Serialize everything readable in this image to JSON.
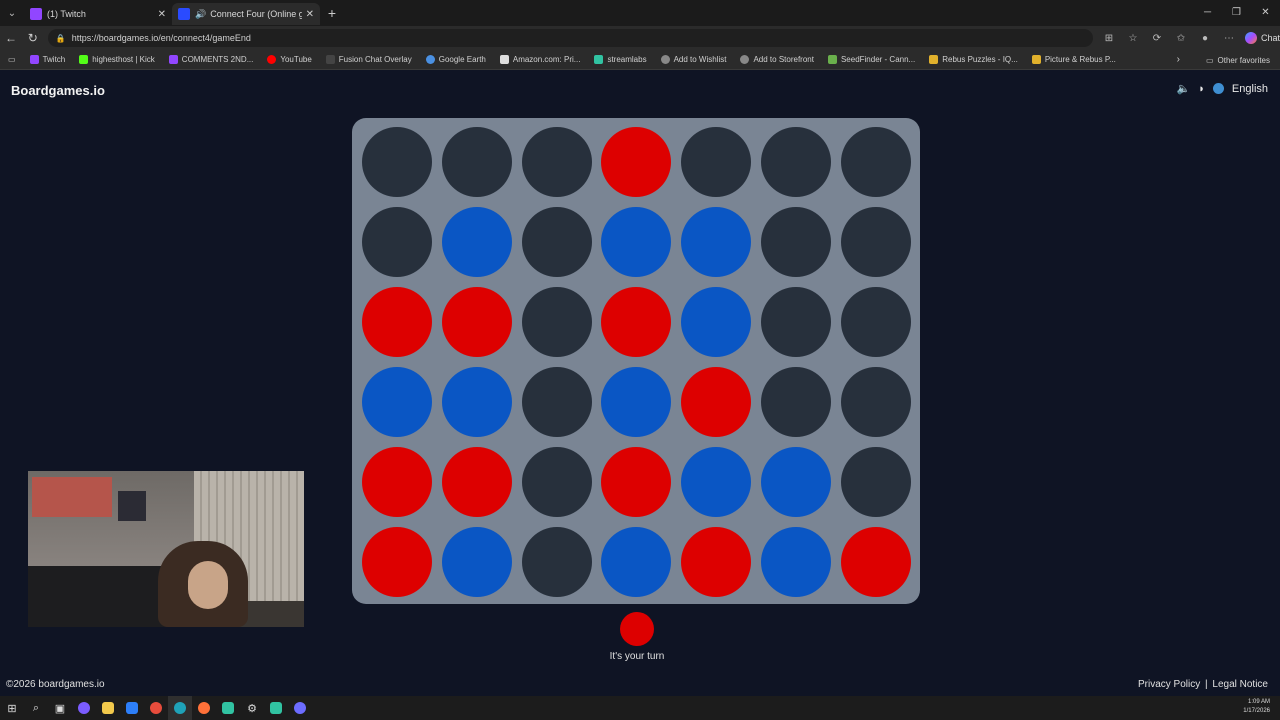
{
  "browser": {
    "tabs": [
      {
        "title": "(1) Twitch",
        "favicon_color": "#9146ff",
        "active": false
      },
      {
        "title": "Connect Four (Online game I",
        "favicon_color": "#2a4bff",
        "active": true
      }
    ],
    "url": "https://boardgames.io/en/connect4/gameEnd",
    "chat_label": "Chat",
    "bookmarks": [
      {
        "label": "Twitch",
        "color": "#9146ff"
      },
      {
        "label": "highesthost | Kick",
        "color": "#53fc18"
      },
      {
        "label": "COMMENTS 2ND...",
        "color": "#9146ff"
      },
      {
        "label": "YouTube",
        "color": "#ff0000"
      },
      {
        "label": "Fusion Chat Overlay",
        "color": "#222222"
      },
      {
        "label": "Google Earth",
        "color": "#4a90e2"
      },
      {
        "label": "Amazon.com: Pri...",
        "color": "#dddddd"
      },
      {
        "label": "streamlabs",
        "color": "#31c3a2"
      },
      {
        "label": "Add to Wishlist",
        "color": "#bbbbbb"
      },
      {
        "label": "Add to Storefront",
        "color": "#bbbbbb"
      },
      {
        "label": "SeedFinder - Cann...",
        "color": "#6ab04c"
      },
      {
        "label": "Rebus Puzzles - IQ...",
        "color": "#e1b12c"
      },
      {
        "label": "Picture & Rebus P...",
        "color": "#e1b12c"
      }
    ],
    "other_favorites": "Other favorites"
  },
  "page": {
    "logo": "Boardgames.io",
    "language": "English",
    "turn_text": "It's your turn",
    "turn_color": "red",
    "copyright": "©2026 boardgames.io",
    "privacy": "Privacy Policy",
    "separator": "|",
    "legal": "Legal Notice"
  },
  "board": {
    "columns": 7,
    "rows": 6,
    "colors": {
      "empty": "#27303c",
      "red": "#dd0000",
      "blue": "#0a56c4"
    },
    "grid": [
      [
        "empty",
        "empty",
        "empty",
        "red",
        "empty",
        "empty",
        "empty"
      ],
      [
        "empty",
        "blue",
        "empty",
        "blue",
        "blue",
        "empty",
        "empty"
      ],
      [
        "red",
        "red",
        "empty",
        "red",
        "blue",
        "empty",
        "empty"
      ],
      [
        "blue",
        "blue",
        "empty",
        "blue",
        "red",
        "empty",
        "empty"
      ],
      [
        "red",
        "red",
        "empty",
        "red",
        "blue",
        "blue",
        "empty"
      ],
      [
        "red",
        "blue",
        "empty",
        "blue",
        "red",
        "blue",
        "red"
      ]
    ]
  },
  "taskbar": {
    "time": "1:09 AM",
    "date": "1/17/2026"
  }
}
